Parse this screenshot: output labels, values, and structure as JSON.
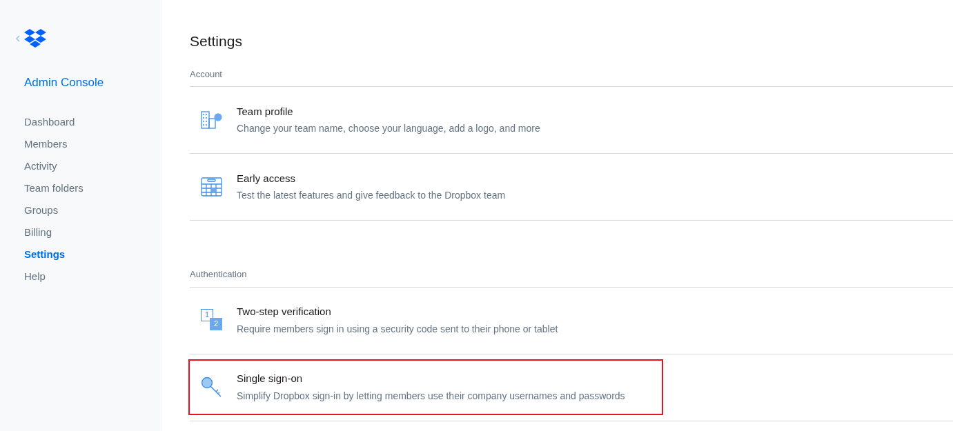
{
  "sidebar": {
    "title": "Admin Console",
    "items": [
      {
        "label": "Dashboard",
        "selected": false
      },
      {
        "label": "Members",
        "selected": false
      },
      {
        "label": "Activity",
        "selected": false
      },
      {
        "label": "Team folders",
        "selected": false
      },
      {
        "label": "Groups",
        "selected": false
      },
      {
        "label": "Billing",
        "selected": false
      },
      {
        "label": "Settings",
        "selected": true
      },
      {
        "label": "Help",
        "selected": false
      }
    ]
  },
  "page_title": "Settings",
  "sections": [
    {
      "heading": "Account",
      "items": [
        {
          "kind": "building",
          "title": "Team profile",
          "description": "Change your team name, choose your language, add a logo, and more",
          "highlighted": false
        },
        {
          "kind": "calendar",
          "title": "Early access",
          "description": "Test the latest features and give feedback to the Dropbox team",
          "highlighted": false
        }
      ]
    },
    {
      "heading": "Authentication",
      "items": [
        {
          "kind": "two-step",
          "icon_labels": [
            "1",
            "2"
          ],
          "title": "Two-step verification",
          "description": "Require members sign in using a security code sent to their phone or tablet",
          "highlighted": false
        },
        {
          "kind": "key",
          "title": "Single sign-on",
          "description": "Simplify Dropbox sign-in by letting members use their company usernames and passwords",
          "highlighted": true
        }
      ]
    }
  ]
}
